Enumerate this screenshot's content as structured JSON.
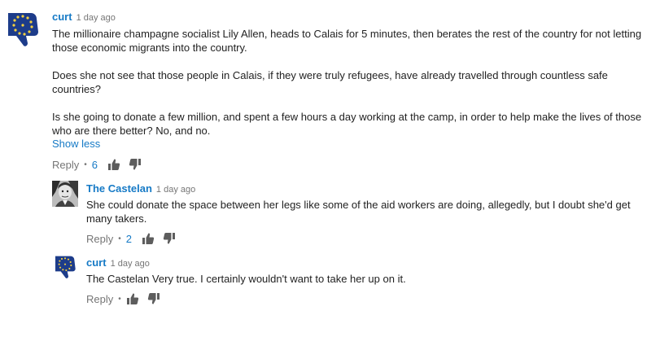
{
  "comments": [
    {
      "author": "curt",
      "time": "1 day ago",
      "paragraphs": [
        "The millionaire champagne socialist Lily Allen, heads to Calais for 5 minutes, then berates the rest of the country for not letting those economic migrants into the country.",
        "Does she not see that those people in Calais, if they were truly refugees, have already travelled through countless safe countries?",
        "Is she going to donate a few million, and spent a few hours a day working at the camp, in order to help make the lives of those who are there better? No, and no."
      ],
      "show_less": "Show less",
      "reply_label": "Reply",
      "likes": "6"
    },
    {
      "author": "The Castelan",
      "time": "1 day ago",
      "text": "She could donate the space between her legs like some of the aid workers are doing, allegedly, but I doubt she'd get many takers.",
      "reply_label": "Reply",
      "likes": "2"
    },
    {
      "author": "curt",
      "time": "1 day ago",
      "text": "The Castelan Very true. I certainly wouldn't want to take her up on it.",
      "reply_label": "Reply"
    }
  ],
  "colors": {
    "link": "#167ac6",
    "meta": "#767676",
    "text": "#222222",
    "eu_blue": "#1d3c8a",
    "eu_star": "#f4d03f"
  },
  "icons": [
    "eu-thumbs-down-avatar",
    "portrait-avatar",
    "thumbs-up-icon",
    "thumbs-down-icon"
  ]
}
